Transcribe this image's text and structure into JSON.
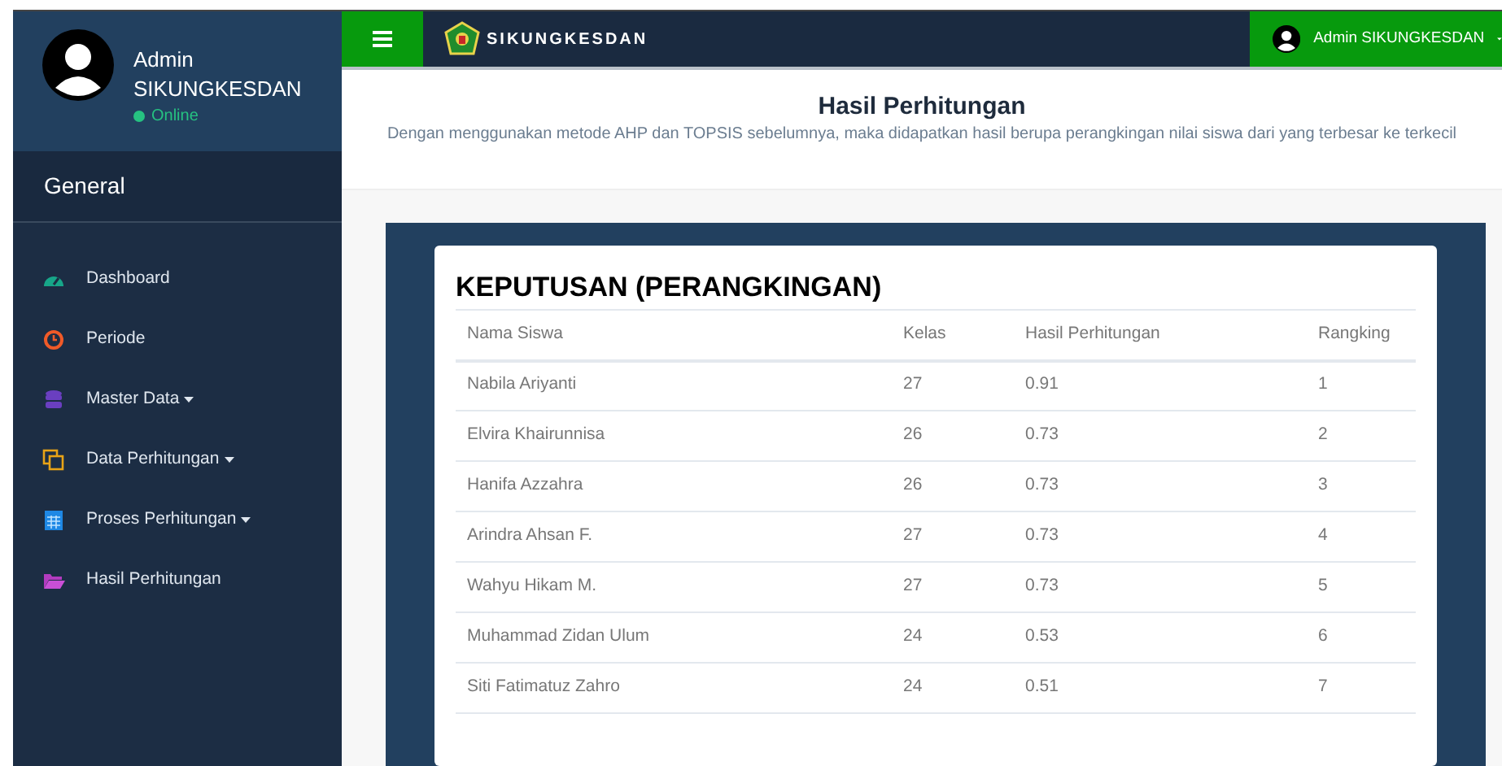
{
  "sidebar": {
    "user": {
      "name": "Admin SIKUNGKESDAN",
      "status": "Online"
    },
    "section": "General",
    "items": [
      {
        "label": "Dashboard",
        "dropdown": false
      },
      {
        "label": "Periode",
        "dropdown": false
      },
      {
        "label": "Master Data",
        "dropdown": true
      },
      {
        "label": "Data Perhitungan",
        "dropdown": true
      },
      {
        "label": "Proses Perhitungan",
        "dropdown": true
      },
      {
        "label": "Hasil Perhitungan",
        "dropdown": false
      }
    ]
  },
  "topbar": {
    "brand": "SIKUNGKESDAN",
    "user": "Admin SIKUNGKESDAN"
  },
  "page": {
    "title": "Hasil Perhitungan",
    "description": "Dengan menggunakan metode AHP dan TOPSIS sebelumnya, maka didapatkan hasil berupa perangkingan nilai siswa dari yang terbesar ke terkecil"
  },
  "table": {
    "title": "KEPUTUSAN (PERANGKINGAN)",
    "columns": [
      "Nama Siswa",
      "Kelas",
      "Hasil Perhitungan",
      "Rangking"
    ],
    "rows": [
      [
        "Nabila Ariyanti",
        "27",
        "0.91",
        "1"
      ],
      [
        "Elvira Khairunnisa",
        "26",
        "0.73",
        "2"
      ],
      [
        "Hanifa Azzahra",
        "26",
        "0.73",
        "3"
      ],
      [
        "Arindra Ahsan F.",
        "27",
        "0.73",
        "4"
      ],
      [
        "Wahyu Hikam M.",
        "27",
        "0.73",
        "5"
      ],
      [
        "Muhammad Zidan Ulum",
        "24",
        "0.53",
        "6"
      ],
      [
        "Siti Fatimatuz Zahro",
        "24",
        "0.51",
        "7"
      ]
    ]
  }
}
